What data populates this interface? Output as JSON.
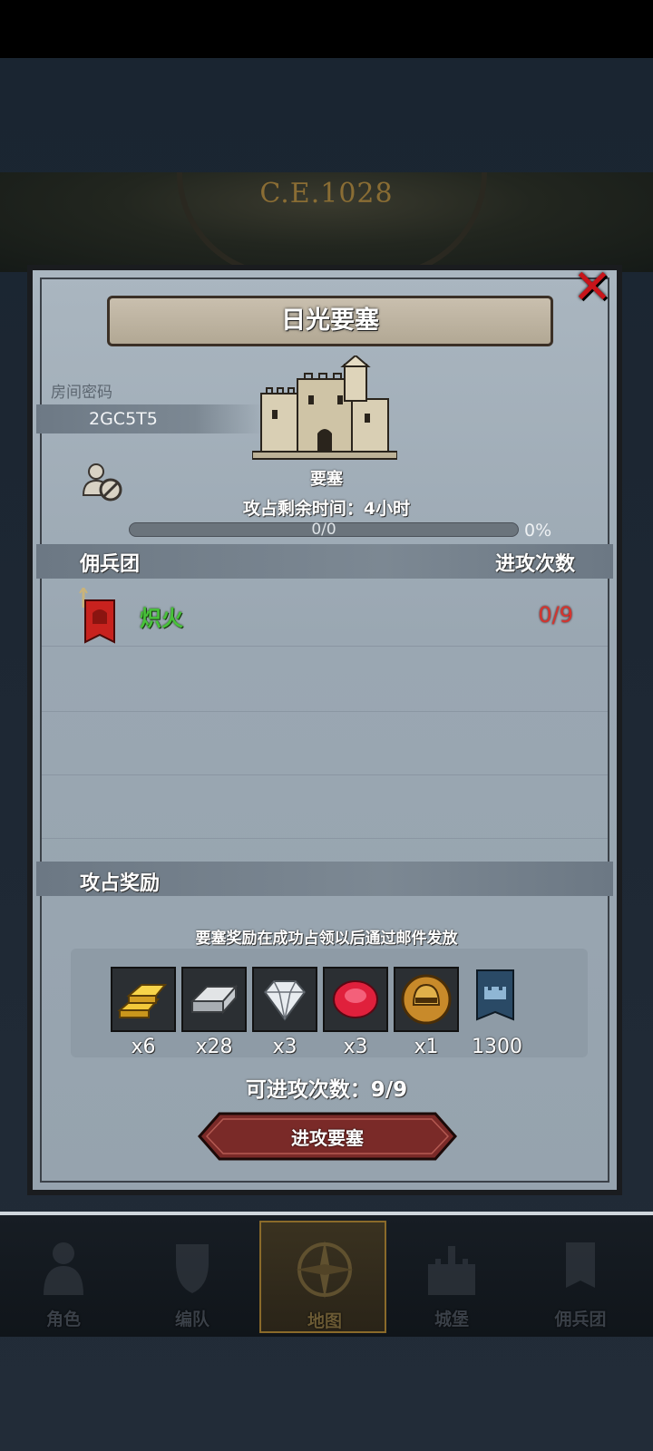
{
  "header": {
    "era": "C.E.1028"
  },
  "dialog": {
    "title": "日光要塞",
    "room_label": "房间密码",
    "room_code": "2GC5T5",
    "fortress_type": "要塞",
    "time_remaining": "攻占剩余时间：4小时",
    "progress": {
      "count": "0/0",
      "percent": "0%",
      "fraction": 0
    }
  },
  "mercenary_section": {
    "left_header": "佣兵团",
    "right_header": "进攻次数",
    "rows": [
      {
        "name": "炽火",
        "attacks": "0/9"
      }
    ]
  },
  "reward_section": {
    "header": "攻占奖励",
    "note": "要塞奖励在成功占领以后通过邮件发放",
    "items": [
      {
        "icon": "gold-bars-icon",
        "qty": "x6"
      },
      {
        "icon": "silver-bar-icon",
        "qty": "x28"
      },
      {
        "icon": "diamond-icon",
        "qty": "x3"
      },
      {
        "icon": "ruby-icon",
        "qty": "x3"
      },
      {
        "icon": "helmet-coin-icon",
        "qty": "x1"
      },
      {
        "icon": "castle-banner-icon",
        "qty": "1300"
      }
    ],
    "attack_count": "可进攻次数：9/9",
    "attack_button": "进攻要塞"
  },
  "nav": {
    "items": [
      {
        "label": "角色",
        "icon": "character-icon"
      },
      {
        "label": "编队",
        "icon": "formation-icon"
      },
      {
        "label": "地图",
        "icon": "map-compass-icon",
        "active": true
      },
      {
        "label": "城堡",
        "icon": "castle-icon"
      },
      {
        "label": "佣兵团",
        "icon": "mercenary-icon"
      }
    ]
  },
  "colors": {
    "accent_red": "#c8141a",
    "merc_green": "#48c23a",
    "attack_red": "#d6342e"
  }
}
